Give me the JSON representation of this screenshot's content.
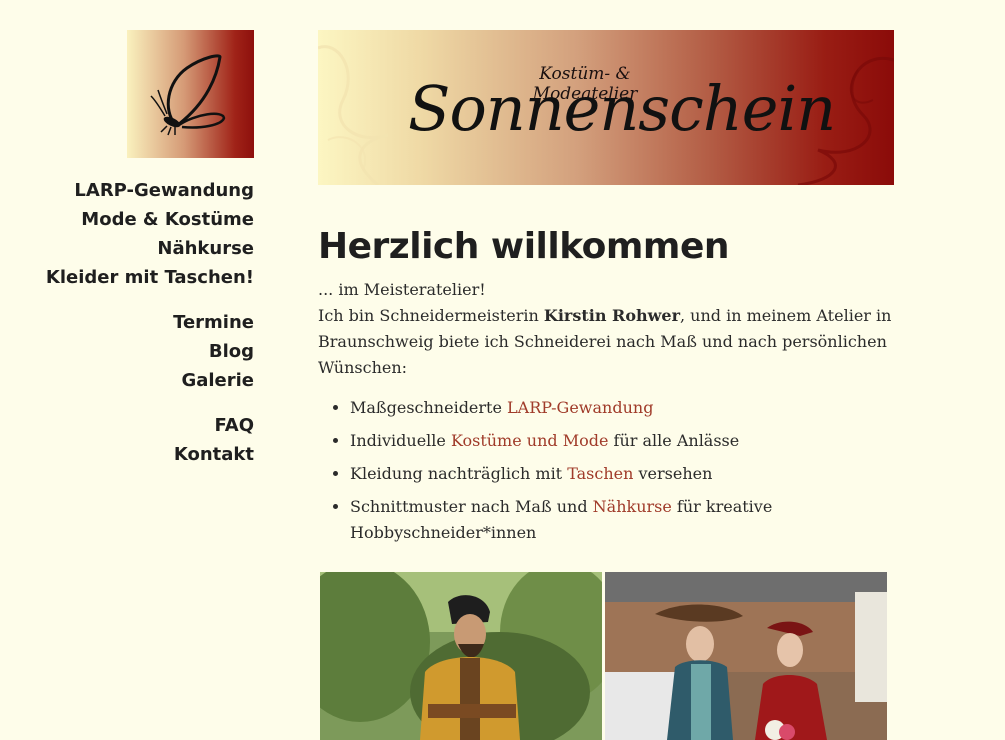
{
  "logo": {
    "icon": "butterfly-icon"
  },
  "nav": {
    "group1": [
      "LARP-Gewandung",
      "Mode & Kostüme",
      "Nähkurse",
      "Kleider mit Taschen!"
    ],
    "group2": [
      "Termine",
      "Blog",
      "Galerie"
    ],
    "group3": [
      "FAQ",
      "Kontakt"
    ]
  },
  "banner": {
    "subtitle": "Kostüm- & Modeatelier",
    "title": "Sonnenschein"
  },
  "main": {
    "heading": "Herzlich willkommen",
    "intro1": "... im Meisteratelier!",
    "intro2_a": "Ich bin Schneidermeisterin ",
    "intro2_name": "Kirstin Rohwer",
    "intro2_b": ", und in meinem Atelier in Braunschweig biete ich Schneiderei nach Maß und nach persönlichen Wünschen:",
    "list": [
      {
        "pre": "Maßgeschneiderte ",
        "link": "LARP-Gewandung",
        "post": ""
      },
      {
        "pre": "Individuelle ",
        "link": "Kostüme und Mode",
        "post": " für alle Anlässe"
      },
      {
        "pre": "Kleidung nachträglich mit ",
        "link": "Taschen",
        "post": " versehen"
      },
      {
        "pre": "Schnittmuster nach Maß und ",
        "link": "Nähkurse",
        "post": " für kreative Hobbyschneider*innen"
      }
    ]
  },
  "colors": {
    "background": "#fefdea",
    "link": "#a03b2a",
    "banner_dark": "#8b0b09"
  }
}
